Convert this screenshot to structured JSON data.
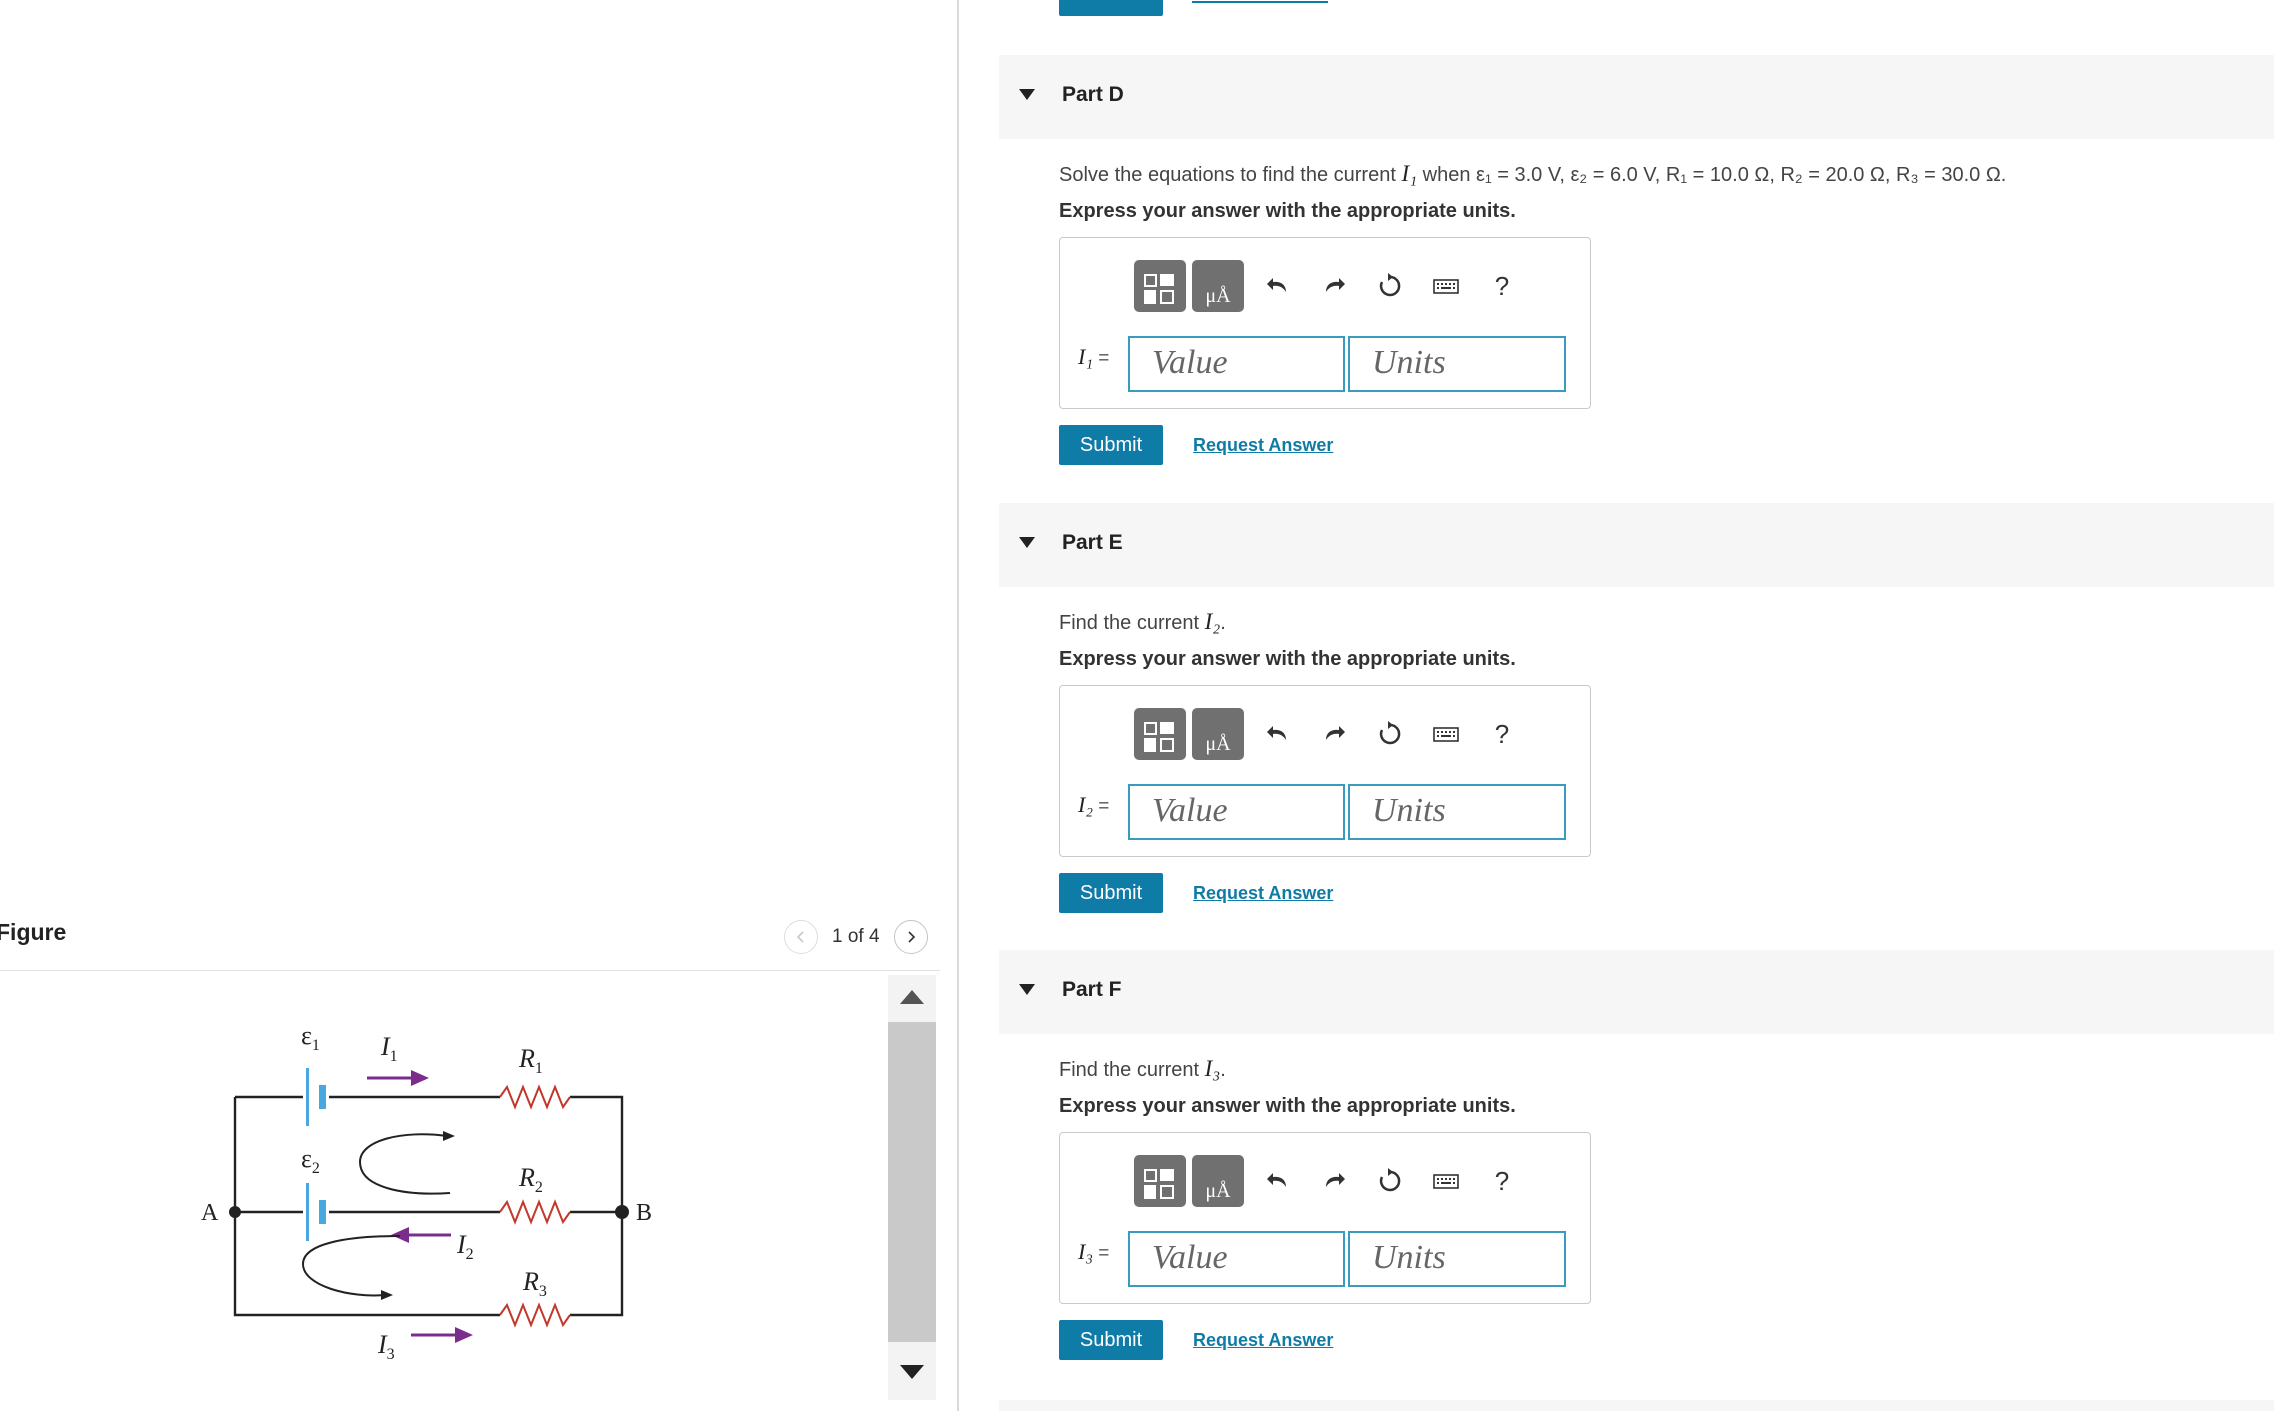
{
  "figure": {
    "title": "Figure",
    "page_indicator": "1 of 4",
    "labels": {
      "emf1": "ε",
      "emf1_sub": "1",
      "emf2": "ε",
      "emf2_sub": "2",
      "i1": "I",
      "i1_sub": "1",
      "i2": "I",
      "i2_sub": "2",
      "i3": "I",
      "i3_sub": "3",
      "r1": "R",
      "r1_sub": "1",
      "r2": "R",
      "r2_sub": "2",
      "r3": "R",
      "r3_sub": "3",
      "node_a": "A",
      "node_b": "B"
    }
  },
  "parts": [
    {
      "title": "Part D",
      "prompt_pre": "Solve the equations to find the current ",
      "prompt_var": "I₁",
      "prompt_post": " when ε₁ = 3.0 V, ε₂ = 6.0 V, R₁ = 10.0 Ω, R₂ = 20.0 Ω, R₃ = 30.0 Ω.",
      "instruction": "Express your answer with the appropriate units.",
      "label": "I₁",
      "eq": " =",
      "value_placeholder": "Value",
      "units_placeholder": "Units",
      "submit": "Submit",
      "request": "Request Answer"
    },
    {
      "title": "Part E",
      "prompt_pre": "Find the current ",
      "prompt_var": "I₂",
      "prompt_post": ".",
      "instruction": "Express your answer with the appropriate units.",
      "label": "I₂",
      "eq": " =",
      "value_placeholder": "Value",
      "units_placeholder": "Units",
      "submit": "Submit",
      "request": "Request Answer"
    },
    {
      "title": "Part F",
      "prompt_pre": "Find the current ",
      "prompt_var": "I₃",
      "prompt_post": ".",
      "instruction": "Express your answer with the appropriate units.",
      "label": "I₃",
      "eq": " =",
      "value_placeholder": "Value",
      "units_placeholder": "Units",
      "submit": "Submit",
      "request": "Request Answer"
    }
  ],
  "toolbar": {
    "units_glyph": "μÅ",
    "help": "?",
    "icons": [
      "templates-icon",
      "units-icon",
      "undo-icon",
      "redo-icon",
      "reset-icon",
      "keyboard-icon",
      "help-icon"
    ]
  },
  "colors": {
    "accent": "#0f7ba7",
    "field_border": "#3a9ac0",
    "emf_plate": "#4aa8e0",
    "current_arrow": "#7b2d8e"
  }
}
